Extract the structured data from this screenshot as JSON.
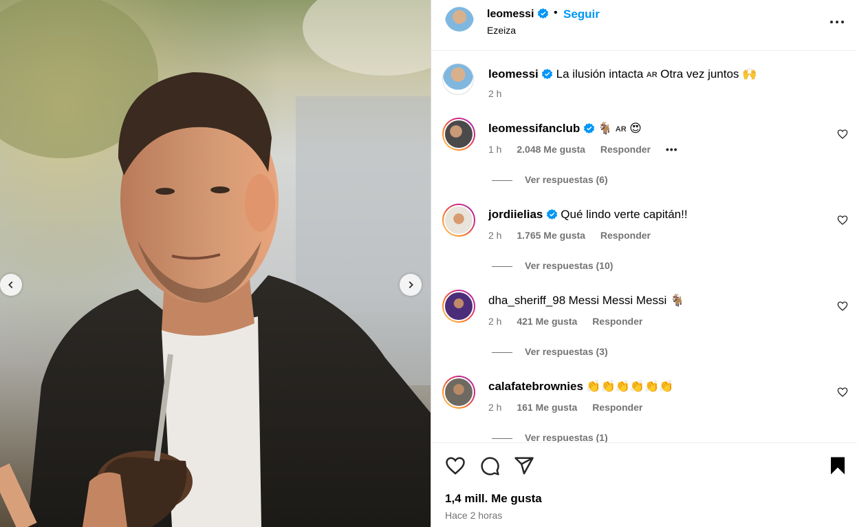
{
  "post": {
    "username": "leomessi",
    "separator": "•",
    "follow_label": "Seguir",
    "location": "Ezeiza",
    "caption_user": "leomessi",
    "caption_text": "La ilusión intacta",
    "caption_flag": "AR",
    "caption_text_2": "Otra vez juntos 🙌",
    "caption_time": "2 h"
  },
  "comments": [
    {
      "user": "leomessifanclub",
      "verified": true,
      "text_emoji_1": "🐐",
      "text_flag": "AR",
      "text_emoji_2": "😍",
      "time": "1 h",
      "likes": "2.048 Me gusta",
      "reply_label": "Responder",
      "more_label": "•••",
      "view_replies": "Ver respuestas (6)"
    },
    {
      "user": "jordiielias",
      "verified": true,
      "text": "Qué lindo verte capitán!!",
      "time": "2 h",
      "likes": "1.765 Me gusta",
      "reply_label": "Responder",
      "view_replies": "Ver respuestas (10)"
    },
    {
      "user": "dha_sheriff_98",
      "verified": false,
      "text": "Messi Messi Messi 🐐",
      "time": "2 h",
      "likes": "421 Me gusta",
      "reply_label": "Responder",
      "view_replies": "Ver respuestas (3)"
    },
    {
      "user": "calafatebrownies",
      "verified": false,
      "text": "👏👏👏👏👏👏",
      "time": "2 h",
      "likes": "161 Me gusta",
      "reply_label": "Responder",
      "view_replies": "Ver respuestas (1)"
    }
  ],
  "footer": {
    "likes": "1,4 mill. Me gusta",
    "posted": "Hace 2 horas"
  },
  "icons": {
    "like": "heart-icon",
    "comment": "comment-icon",
    "share": "share-icon",
    "save": "bookmark-icon",
    "verified": "verified-badge-icon",
    "more": "more-options-icon",
    "prev": "chevron-left-icon",
    "next": "chevron-right-icon"
  },
  "colors": {
    "link": "#0095f6",
    "verified": "#0095f6",
    "secondary_text": "#737373"
  }
}
